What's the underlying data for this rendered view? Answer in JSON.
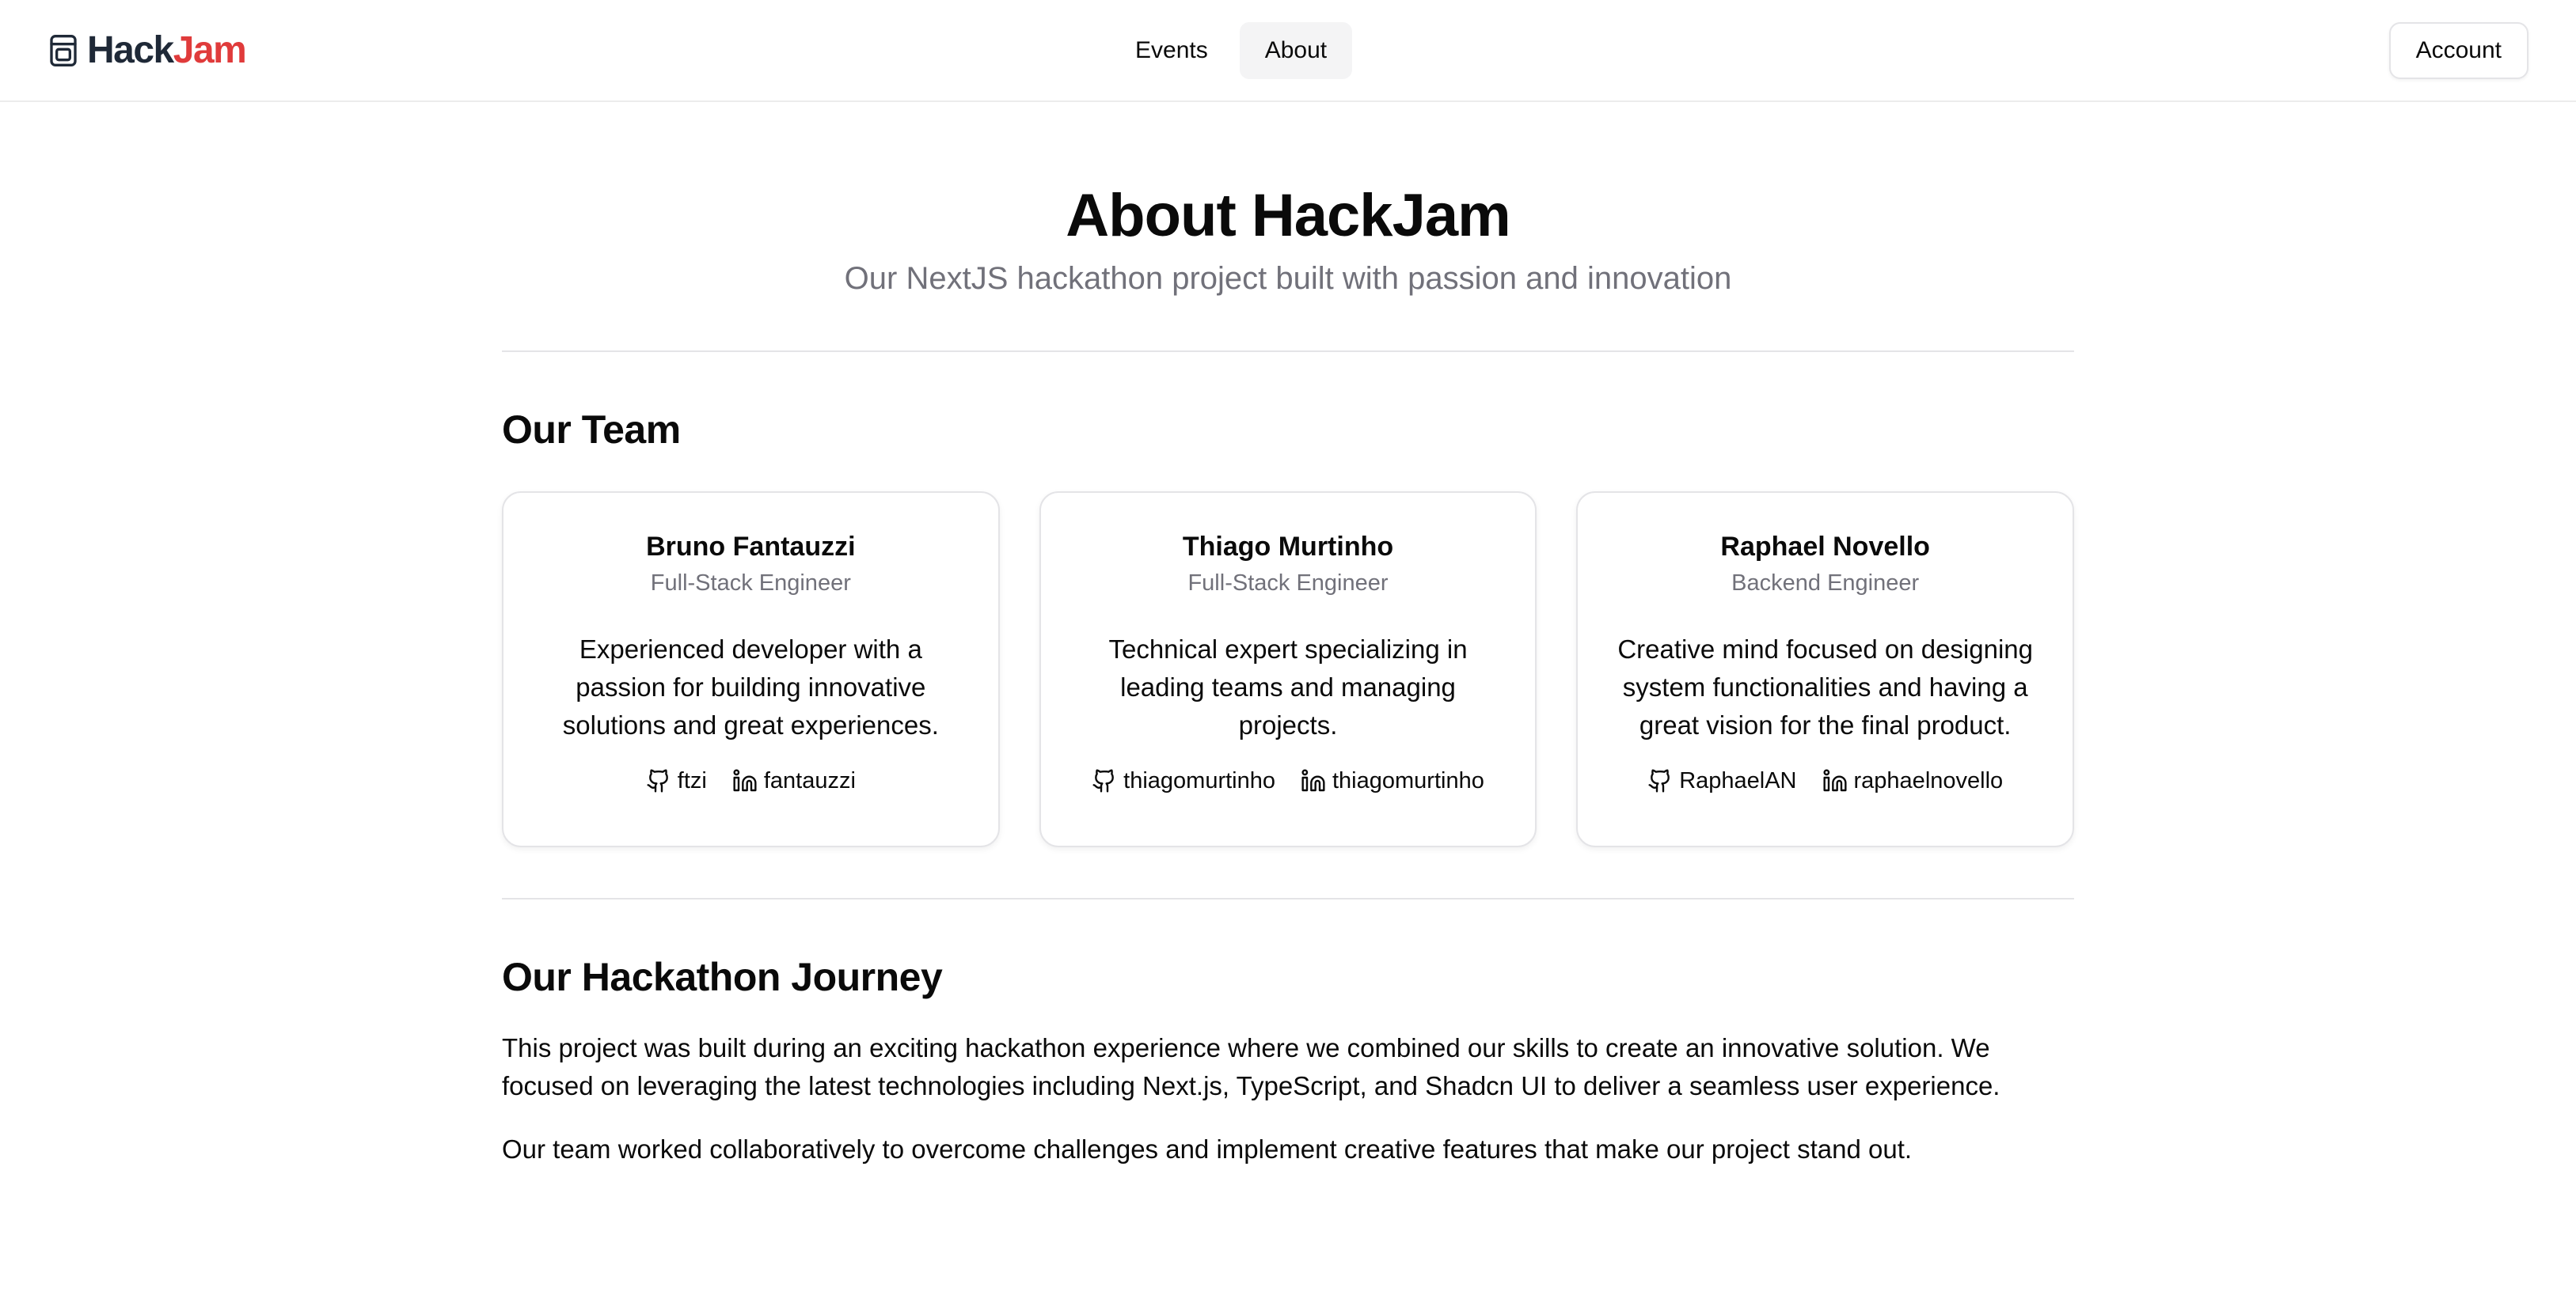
{
  "header": {
    "logo": {
      "icon": "box-icon",
      "text_primary": "Hack",
      "text_accent": "Jam",
      "accent_color": "#e03b3b"
    },
    "nav": [
      {
        "label": "Events",
        "active": false
      },
      {
        "label": "About",
        "active": true
      }
    ],
    "account_label": "Account"
  },
  "main": {
    "title": "About HackJam",
    "subtitle": "Our NextJS hackathon project built with passion and innovation",
    "team": {
      "heading": "Our Team",
      "members": [
        {
          "name": "Bruno Fantauzzi",
          "role": "Full-Stack Engineer",
          "bio": "Experienced developer with a passion for building innovative solutions and great experiences.",
          "github": "ftzi",
          "linkedin": "fantauzzi"
        },
        {
          "name": "Thiago Murtinho",
          "role": "Full-Stack Engineer",
          "bio": "Technical expert specializing in leading teams and managing projects.",
          "github": "thiagomurtinho",
          "linkedin": "thiagomurtinho"
        },
        {
          "name": "Raphael Novello",
          "role": "Backend Engineer",
          "bio": "Creative mind focused on designing system functionalities and having a great vision for the final product.",
          "github": "RaphaelAN",
          "linkedin": "raphaelnovello"
        }
      ]
    },
    "journey": {
      "heading": "Our Hackathon Journey",
      "paragraphs": [
        "This project was built during an exciting hackathon experience where we combined our skills to create an innovative solution. We focused on leveraging the latest technologies including Next.js, TypeScript, and Shadcn UI to deliver a seamless user experience.",
        "Our team worked collaboratively to overcome challenges and implement creative features that make our project stand out."
      ]
    }
  }
}
